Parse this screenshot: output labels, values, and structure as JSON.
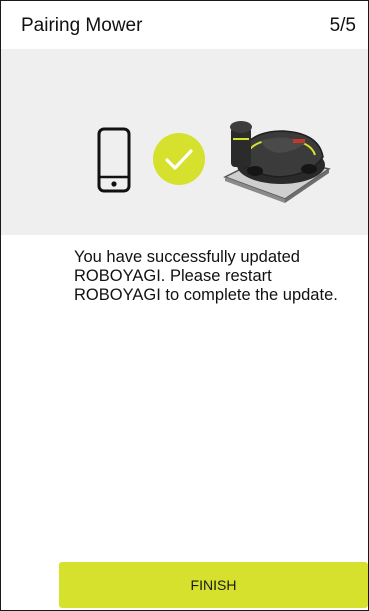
{
  "header": {
    "title": "Pairing Mower",
    "step": "5/5"
  },
  "hero": {
    "icons": [
      "smartphone-icon",
      "check-circle-icon",
      "robot-mower-illustration"
    ],
    "background_color": "#efefef",
    "check_color": "#d6e12e"
  },
  "message": "You have successfully updated ROBOYAGI. Please restart ROBOYAGI to complete the update.",
  "footer": {
    "finish_label": "FINISH",
    "button_color": "#d6e12e"
  }
}
